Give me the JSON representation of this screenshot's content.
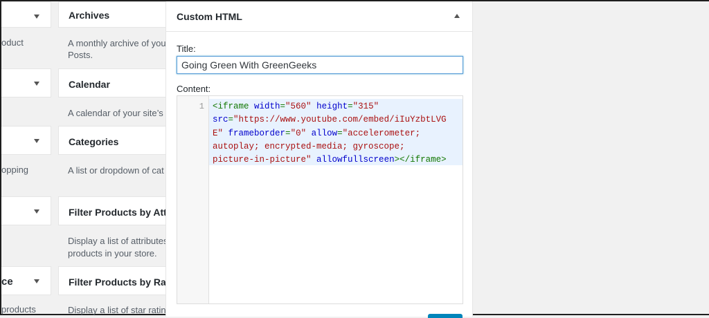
{
  "sidebar_areas": [
    {
      "label": "",
      "desc": "oduct"
    },
    {
      "label": "",
      "desc": ""
    },
    {
      "label": "",
      "desc": "opping"
    },
    {
      "label": "",
      "desc": ""
    },
    {
      "label": "ce",
      "desc": "products"
    }
  ],
  "widgets": [
    {
      "title": "Archives",
      "desc_line1": "A monthly archive of you",
      "desc_line2": "Posts."
    },
    {
      "title": "Calendar",
      "desc_line1": "A calendar of your site’s",
      "desc_line2": ""
    },
    {
      "title": "Categories",
      "desc_line1": "A list or dropdown of cat",
      "desc_line2": ""
    },
    {
      "title": "Filter Products by Att…",
      "desc_line1": "Display a list of attributes",
      "desc_line2": "products in your store."
    },
    {
      "title": "Filter Products by Rat…",
      "desc_line1": "Display a list of star ratin",
      "desc_line2": ""
    }
  ],
  "panel": {
    "title": "Custom HTML",
    "title_label": "Title:",
    "title_value": "Going Green With GreenGeeks",
    "content_label": "Content:",
    "line_number": "1"
  },
  "code": {
    "line1": [
      "<iframe ",
      "width",
      "=",
      "\"560\"",
      " ",
      "height",
      "=",
      "\"315\""
    ],
    "line2": [
      "src",
      "=",
      "\"https://www.youtube.com/embed/iIuYzbtLVG"
    ],
    "line3": [
      "E\"",
      " ",
      "frameborder",
      "=",
      "\"0\"",
      " ",
      "allow",
      "=",
      "\"accelerometer;"
    ],
    "line4": "autoplay; encrypted-media; gyroscope;",
    "line5": [
      "picture-in-picture\"",
      " ",
      "allowfullscreen",
      "></iframe>"
    ]
  }
}
